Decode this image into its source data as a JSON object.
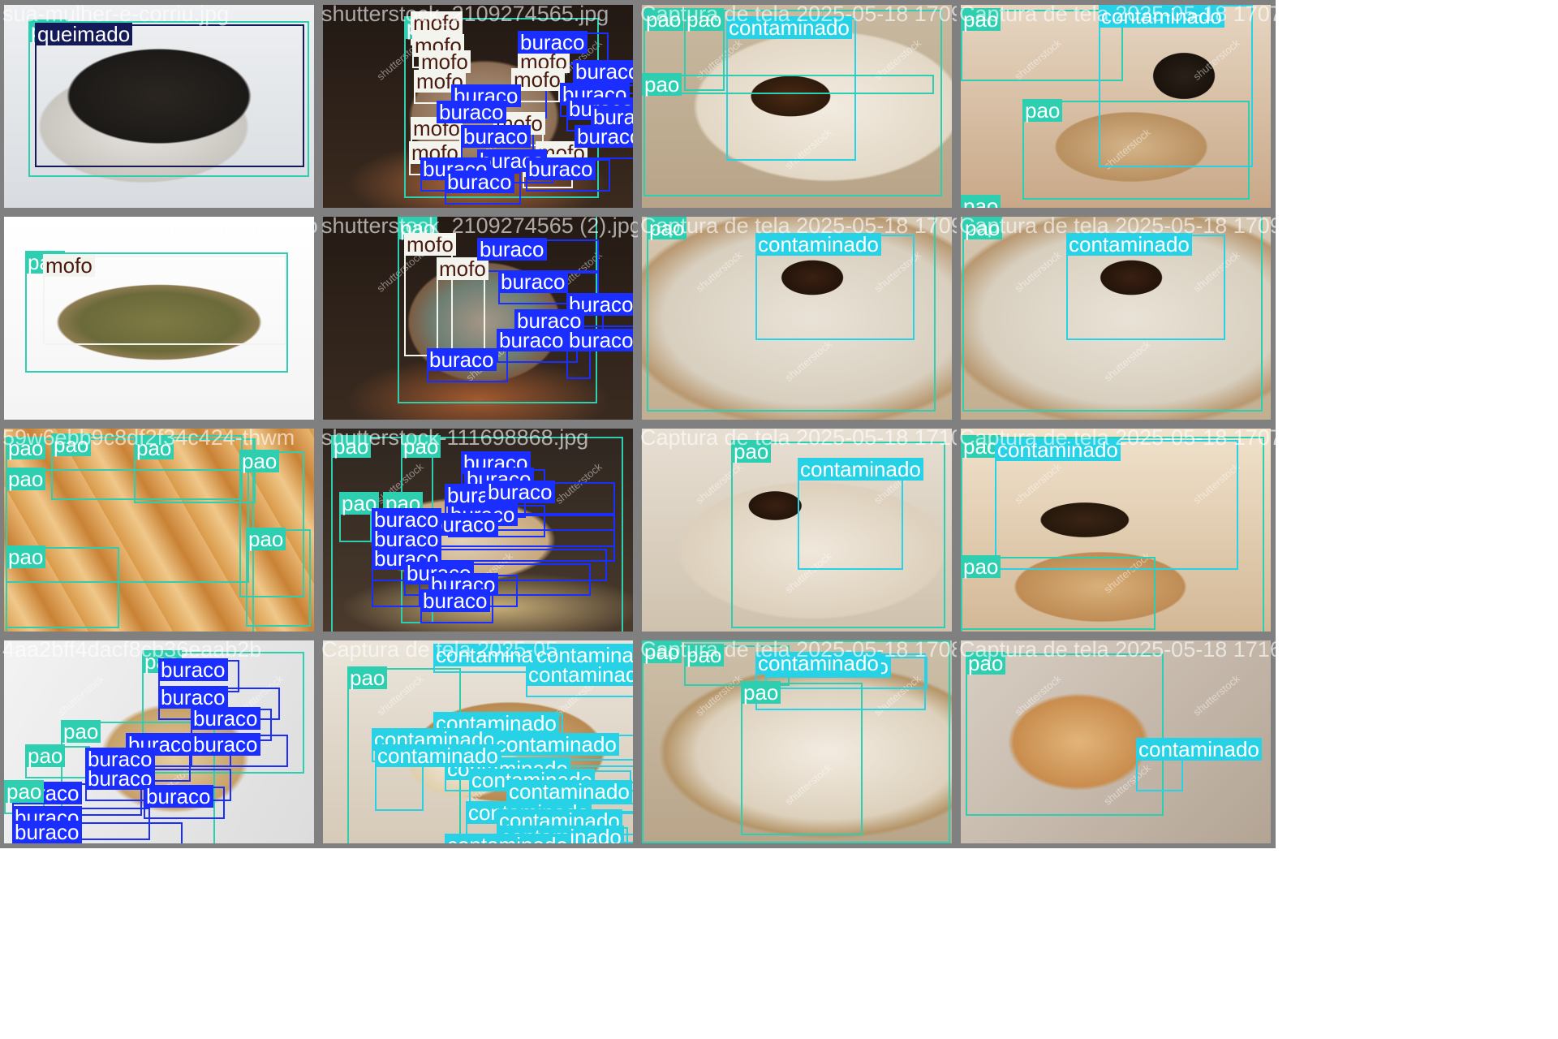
{
  "colors": {
    "pao": "#2ecfb0",
    "contaminado": "#27d2e6",
    "buraco": "#1a2fff",
    "mofo": "#f4f4ef",
    "queimado": "#141a57",
    "cell_border": "#808080"
  },
  "classes": {
    "pao": "pao",
    "contaminado": "contaminado",
    "buraco": "buraco",
    "mofo": "mofo",
    "queimado": "queimado"
  },
  "cells": [
    {
      "filename": "sua-mulher-e-corriu.jpg",
      "scene": "burnt toast on plate"
    },
    {
      "filename": "shutterstock_2109274565.jpg",
      "scene": "moldy sourdough loaf"
    },
    {
      "filename": "Captura de tela 2025-05-18 1709",
      "scene": "cockroach on bread slice"
    },
    {
      "filename": "Captura de tela 2025-05-18 1707",
      "scene": "cockroach on cookie"
    },
    {
      "filename": "19564435-a-imagem-de-um-pao-mofado",
      "scene": "moldy bread slice"
    },
    {
      "filename": "shutterstock_2109274565 (2).jpg",
      "scene": "moldy loaf cut"
    },
    {
      "filename": "Captura de tela 2025-05-18 1709",
      "scene": "cockroach on bread"
    },
    {
      "filename": "Captura de tela 2025-05-18 1709",
      "scene": "cockroach on bread"
    },
    {
      "filename": "59w6ebb9c8df2f34c424-thwm",
      "scene": "baguettes"
    },
    {
      "filename": "shutterstock-111698868.jpg",
      "scene": "rustic loaf with holes"
    },
    {
      "filename": "Captura de tela 2025-05-18 1710",
      "scene": "cockroach on bread"
    },
    {
      "filename": "Captura de tela 2025-05-18 1707",
      "scene": "cockroaches on cookie"
    },
    {
      "filename": "4aa2bff4dacf8cb36eaab2b",
      "scene": "sliced bread with holes"
    },
    {
      "filename": "Captura de tela 2025-05",
      "scene": "roaches on bread"
    },
    {
      "filename": "Captura de tela 2025-05-18 1708",
      "scene": "cockroach on bread slice"
    },
    {
      "filename": "Captura de tela 2025-05-18 1716",
      "scene": "hamburger bun with roach"
    }
  ],
  "watermark": "shutterstock"
}
